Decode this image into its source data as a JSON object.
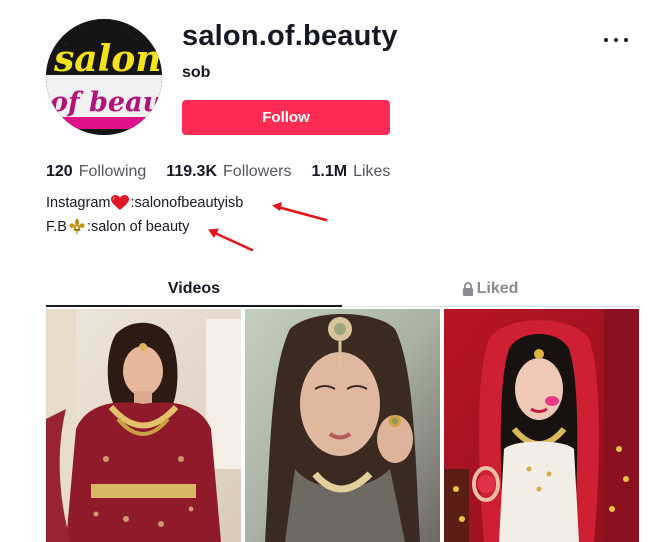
{
  "profile": {
    "username": "salon.of.beauty",
    "nickname": "sob",
    "follow_label": "Follow",
    "avatar_text_line1": "salon",
    "avatar_text_line2": "of beauty"
  },
  "stats": {
    "following": {
      "count": "120",
      "label": "Following"
    },
    "followers": {
      "count": "119.3K",
      "label": "Followers"
    },
    "likes": {
      "count": "1.1M",
      "label": "Likes"
    }
  },
  "bio": {
    "line1_prefix": "Instagram",
    "line1_icon": "red-heart-icon",
    "line1_suffix": ":salonofbeautyisb",
    "line2_prefix": "F.B",
    "line2_icon": "fleur-de-lis-icon",
    "line2_suffix": ":salon of beauty"
  },
  "tabs": {
    "videos": "Videos",
    "liked": "Liked"
  },
  "colors": {
    "accent": "#fe2c55",
    "annotation_arrow": "#e3151a"
  },
  "videos": [
    {
      "thumbnail": "bride-red-lehenga"
    },
    {
      "thumbnail": "bride-gold-jewelry"
    },
    {
      "thumbnail": "bride-red-dupatta"
    }
  ]
}
